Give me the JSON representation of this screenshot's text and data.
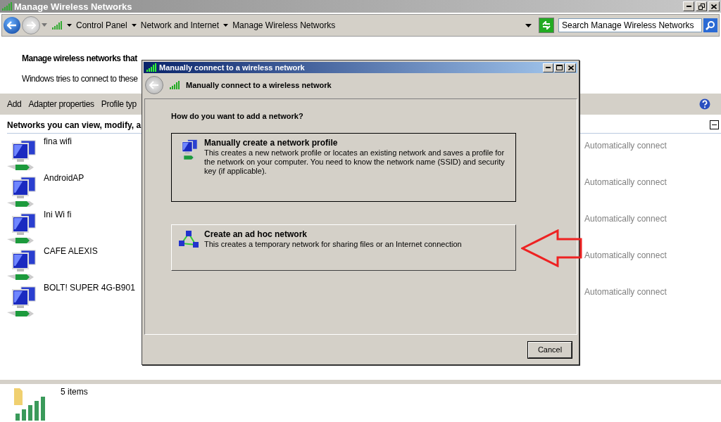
{
  "window": {
    "title": "Manage Wireless Networks"
  },
  "address_bar": {
    "breadcrumbs": [
      "Control Panel",
      "Network and Internet",
      "Manage Wireless Networks"
    ]
  },
  "search": {
    "placeholder": "Search Manage Wireless Networks"
  },
  "heading": "Manage wireless networks that",
  "description": "Windows tries to connect to these",
  "toolbar": [
    "Add",
    "Adapter properties",
    "Profile typ"
  ],
  "section": {
    "title": "Networks you can view, modify, a"
  },
  "networks": [
    {
      "name": "fina wifi",
      "mode": "Automatically connect"
    },
    {
      "name": "AndroidAP",
      "mode": "Automatically connect"
    },
    {
      "name": "Ini Wi fi",
      "mode": "Automatically connect"
    },
    {
      "name": "CAFE ALEXIS",
      "mode": "Automatically connect"
    },
    {
      "name": "BOLT! SUPER 4G-B901",
      "mode": "Automatically connect"
    }
  ],
  "status_bar": {
    "count": "5 items"
  },
  "dialog": {
    "title": "Manually connect to a wireless network",
    "header": "Manually connect to a wireless network",
    "question": "How do you want to add a network?",
    "options": [
      {
        "kind": "profile",
        "title": "Manually create a network profile",
        "description": "This creates a new network profile or locates an existing network and saves a profile for the network on your computer. You need to know the network name (SSID) and security key (if applicable).",
        "highlighted": false
      },
      {
        "kind": "adhoc",
        "title": "Create an ad hoc network",
        "description": "This creates a temporary network for sharing files or an Internet connection",
        "highlighted": true
      }
    ],
    "buttons": [
      "Cancel"
    ]
  }
}
